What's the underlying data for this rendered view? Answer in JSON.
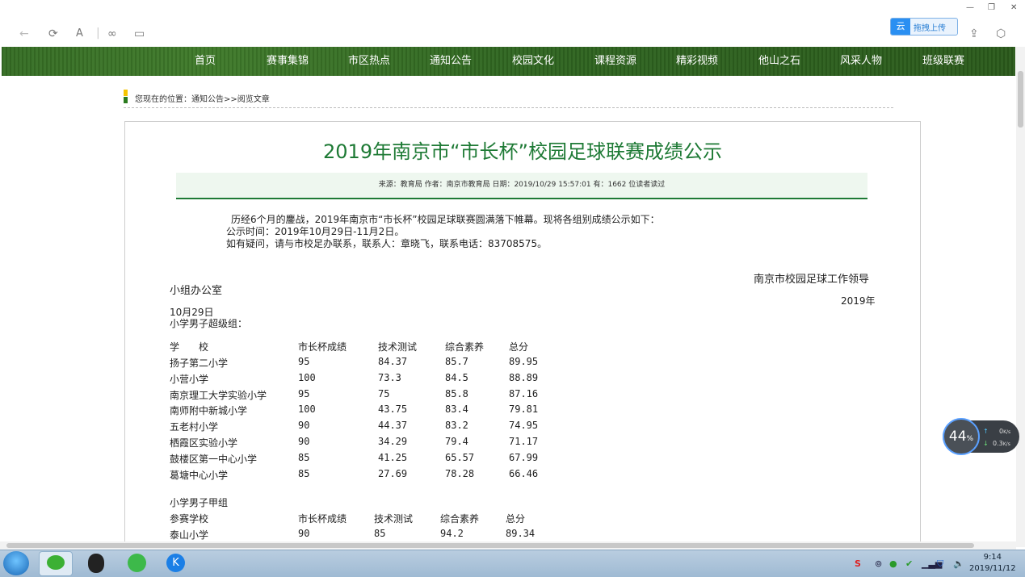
{
  "browser": {
    "upload_label": "拖拽上传",
    "upload_logo": "云"
  },
  "nav": {
    "items": [
      "首页",
      "赛事集锦",
      "市区热点",
      "通知公告",
      "校园文化",
      "课程资源",
      "精彩视频",
      "他山之石",
      "风采人物",
      "班级联赛"
    ]
  },
  "breadcrumb": {
    "prefix": "您现在的位置：",
    "path": "通知公告>>阅览文章"
  },
  "article": {
    "title": "2019年南京市“市长杯”校园足球联赛成绩公示",
    "meta": "来源：教育局 作者：南京市教育局 日期：2019/10/29 15:57:01  有：1662 位读者读过",
    "intro1": "历经6个月的鏖战，2019年南京市“市长杯”校园足球联赛圆满落下帷幕。现将各组别成绩公示如下：",
    "intro2": "公示时间：2019年10月29日-11月2日。",
    "intro3": "如有疑问，请与市校足办联系，联系人：章晓飞，联系电话：83708575。",
    "sign1": "南京市校园足球工作领导",
    "sign2": "小组办公室",
    "sign_year": "2019年",
    "sign_date": "10月29日",
    "group1_title": "小学男子超级组：",
    "group1_headers": [
      "学　　校",
      "市长杯成绩",
      "技术测试",
      "综合素养",
      "总分"
    ],
    "group1_rows": [
      [
        "扬子第二小学",
        "95",
        "84.37",
        "85.7",
        "89.95"
      ],
      [
        "小营小学",
        "100",
        "73.3",
        "84.5",
        "88.89"
      ],
      [
        "南京理工大学实验小学",
        "95",
        "75",
        "85.8",
        "87.16"
      ],
      [
        "南师附中新城小学",
        "100",
        "43.75",
        "83.4",
        "79.81"
      ],
      [
        "五老村小学",
        "90",
        "44.37",
        "83.2",
        "74.95"
      ],
      [
        "栖霞区实验小学",
        "90",
        "34.29",
        "79.4",
        "71.17"
      ],
      [
        "鼓楼区第一中心小学",
        "85",
        "41.25",
        "65.57",
        "67.99"
      ],
      [
        "葛塘中心小学",
        "85",
        "27.69",
        "78.28",
        "66.46"
      ]
    ],
    "group2_title": "小学男子甲组",
    "group2_headers": [
      "参赛学校",
      "市长杯成绩",
      "技术测试",
      "综合素养",
      "总分"
    ],
    "group2_rows": [
      [
        "泰山小学",
        "90",
        "85",
        "94.2",
        "89.34"
      ]
    ]
  },
  "speed_widget": {
    "percent": "44",
    "percent_unit": "%",
    "up": "0",
    "down": "0.3",
    "unit": "K/s"
  },
  "taskbar": {
    "time": "9:14",
    "date": "2019/11/12"
  }
}
